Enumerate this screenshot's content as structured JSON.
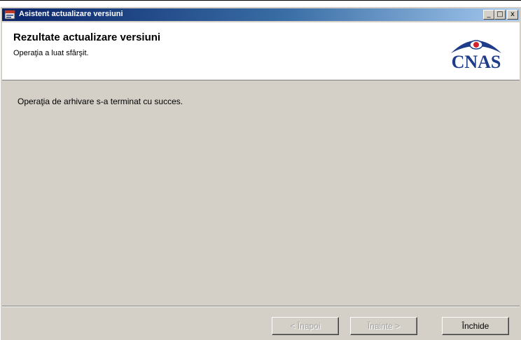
{
  "window": {
    "title": "Asistent actualizare versiuni",
    "controls": {
      "minimize": "_",
      "maximize": "□",
      "close": "x"
    }
  },
  "header": {
    "title": "Rezultate actualizare versiuni",
    "subtitle": "Operaţia a luat sfârşit.",
    "logo_text": "CNAS"
  },
  "content": {
    "message": "Operaţia de arhivare s-a terminat cu succes."
  },
  "buttons": {
    "back_label": "< Înapoi",
    "next_label": "Înainte >",
    "close_label": "Închide"
  },
  "colors": {
    "titlebar_start": "#0a246a",
    "titlebar_end": "#a6caf0",
    "logo_blue": "#1f3c8a",
    "logo_red": "#d4202a"
  }
}
